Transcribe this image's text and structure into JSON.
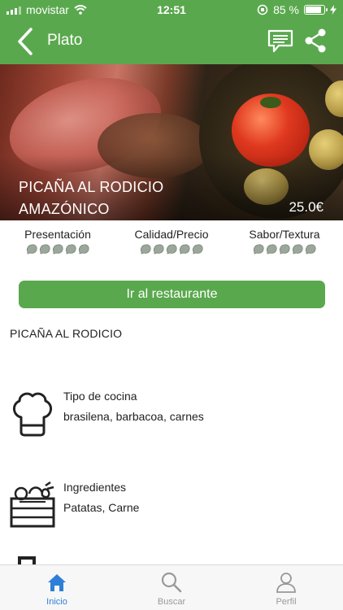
{
  "status_bar": {
    "carrier": "movistar",
    "time": "12:51",
    "battery": "85 %"
  },
  "navbar": {
    "title": "Plato",
    "back_icon": "chevron-left-icon",
    "comments_icon": "comments-icon",
    "share_icon": "share-icon"
  },
  "hero": {
    "title": "PICAÑA AL RODICIO AMAZÓNICO",
    "price": "25.0€"
  },
  "ratings": [
    {
      "label": "Presentación",
      "rating_out_of_5": 0
    },
    {
      "label": "Calidad/Precio",
      "rating_out_of_5": 0
    },
    {
      "label": "Sabor/Textura",
      "rating_out_of_5": 0
    }
  ],
  "button": {
    "label": "Ir al restaurante"
  },
  "dish_name": "PICAÑA AL RODICIO",
  "cuisine": {
    "label": "Tipo de cocina",
    "value": "brasilena, barbacoa, carnes",
    "icon": "chef-hat-icon"
  },
  "ingredients": {
    "label": "Ingredientes",
    "value": "Patatas, Carne",
    "icon": "produce-crate-icon"
  },
  "tabbar": {
    "active": "Inicio",
    "tabs": [
      {
        "label": "Inicio",
        "icon": "home-icon"
      },
      {
        "label": "Buscar",
        "icon": "search-icon"
      },
      {
        "label": "Perfil",
        "icon": "profile-icon"
      }
    ]
  },
  "colors": {
    "primary": "#5aa84e",
    "rating_icon": "#9aa79a",
    "tab_active": "#2f7fd8",
    "tab_inactive": "#999999"
  }
}
